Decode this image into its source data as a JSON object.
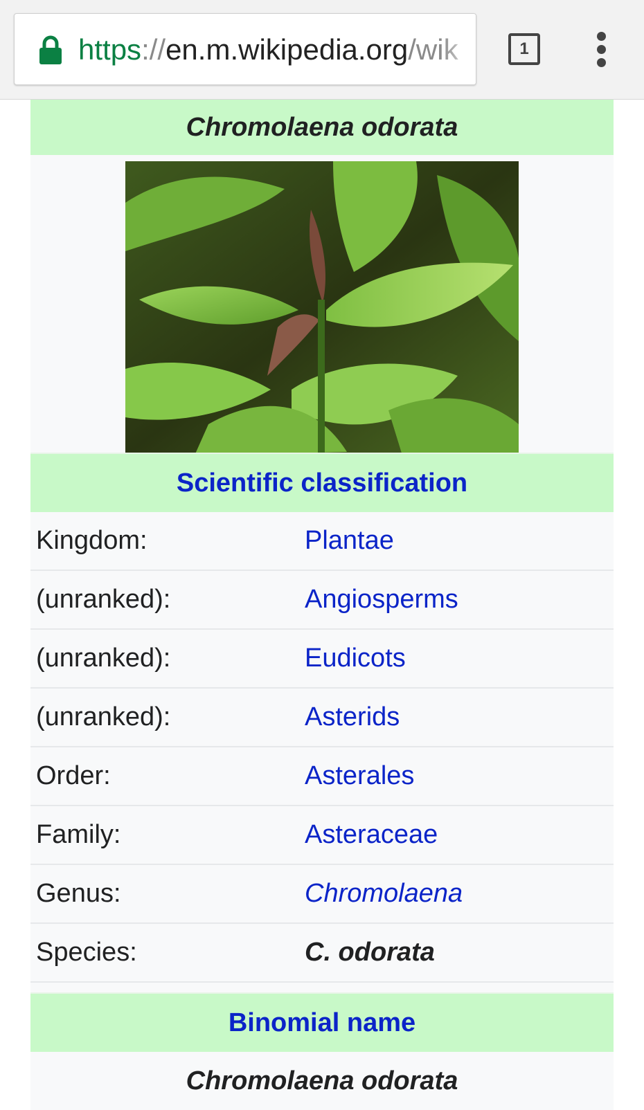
{
  "browser": {
    "url": {
      "scheme": "https",
      "separator": "://",
      "host": "en.m.wikipedia.org",
      "path": "/wik"
    },
    "tab_count": "1",
    "lock_icon": "lock-icon",
    "menu_icon": "more-vert-icon",
    "colors": {
      "secure_green": "#0b8043",
      "toolbar_bg": "#f2f2f2"
    }
  },
  "infobox": {
    "title": "Chromolaena odorata",
    "image_alt": "plant-photo",
    "classification_heading": "Scientific classification",
    "rows": [
      {
        "label": "Kingdom:",
        "value": "Plantae",
        "style": "link"
      },
      {
        "label": "(unranked):",
        "value": "Angiosperms",
        "style": "link"
      },
      {
        "label": "(unranked):",
        "value": "Eudicots",
        "style": "link"
      },
      {
        "label": "(unranked):",
        "value": "Asterids",
        "style": "link"
      },
      {
        "label": "Order:",
        "value": "Asterales",
        "style": "link"
      },
      {
        "label": "Family:",
        "value": "Asteraceae",
        "style": "link"
      },
      {
        "label": "Genus:",
        "value": "Chromolaena",
        "style": "link-italic"
      },
      {
        "label": "Species:",
        "value": "C. odorata",
        "style": "bold-italic"
      }
    ],
    "binomial_heading": "Binomial name",
    "binomial": "Chromolaena odorata",
    "colors": {
      "header_bg": "#c8f9c8",
      "link": "#0b24c8",
      "body_bg": "#f8f9fa"
    }
  }
}
